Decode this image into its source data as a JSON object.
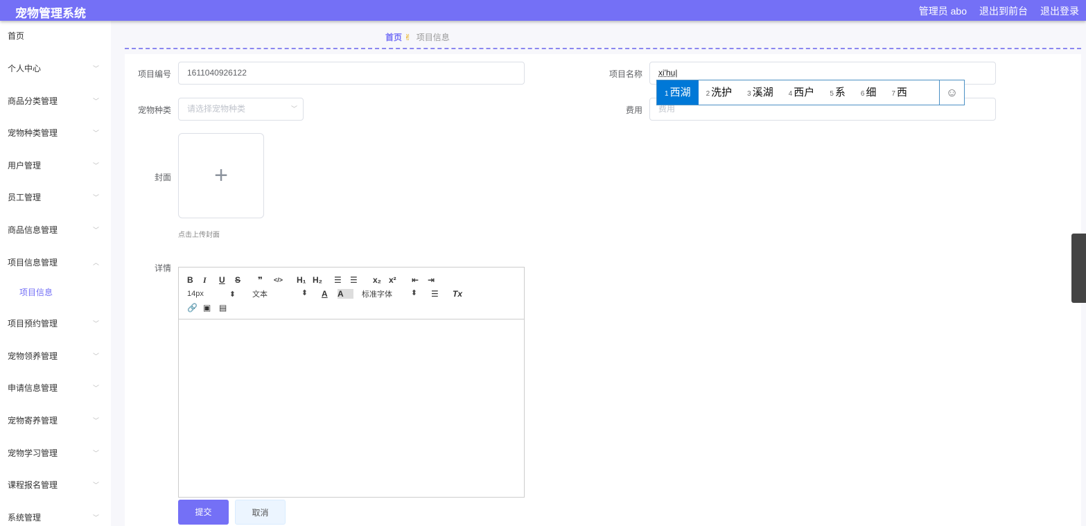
{
  "header": {
    "title": "宠物管理系统",
    "user": "管理员 abo",
    "front": "退出到前台",
    "logout": "退出登录"
  },
  "sidebar": {
    "items": [
      {
        "label": "首页",
        "chevron": ""
      },
      {
        "label": "个人中心",
        "chevron": "﹀"
      },
      {
        "label": "商品分类管理",
        "chevron": "﹀"
      },
      {
        "label": "宠物种类管理",
        "chevron": "﹀"
      },
      {
        "label": "用户管理",
        "chevron": "﹀"
      },
      {
        "label": "员工管理",
        "chevron": "﹀"
      },
      {
        "label": "商品信息管理",
        "chevron": "﹀"
      },
      {
        "label": "项目信息管理",
        "chevron": "︿"
      },
      {
        "label": "项目信息",
        "chevron": ""
      },
      {
        "label": "项目预约管理",
        "chevron": "﹀"
      },
      {
        "label": "宠物领养管理",
        "chevron": "﹀"
      },
      {
        "label": "申请信息管理",
        "chevron": "﹀"
      },
      {
        "label": "宠物寄养管理",
        "chevron": "﹀"
      },
      {
        "label": "宠物学习管理",
        "chevron": "﹀"
      },
      {
        "label": "课程报名管理",
        "chevron": "﹀"
      },
      {
        "label": "系统管理",
        "chevron": "﹀"
      }
    ]
  },
  "breadcrumb": {
    "home": "首页",
    "icon": "✌",
    "current": "项目信息"
  },
  "form": {
    "code_label": "项目编号",
    "code_value": "1611040926122",
    "name_label": "项目名称",
    "name_value": "xi'hu",
    "species_label": "宠物种类",
    "species_placeholder": "请选择宠物种类",
    "fee_label": "费用",
    "fee_placeholder": "费用",
    "cover_label": "封面",
    "cover_hint": "点击上传封面",
    "detail_label": "详情",
    "submit": "提交",
    "cancel": "取消"
  },
  "editor": {
    "size": "14px",
    "header": "文本",
    "font": "标准字体"
  },
  "ime": {
    "candidates": [
      {
        "n": "1",
        "t": "西湖"
      },
      {
        "n": "2",
        "t": "洗护"
      },
      {
        "n": "3",
        "t": "溪湖"
      },
      {
        "n": "4",
        "t": "西户"
      },
      {
        "n": "5",
        "t": "系"
      },
      {
        "n": "6",
        "t": "细"
      },
      {
        "n": "7",
        "t": "西"
      }
    ]
  }
}
